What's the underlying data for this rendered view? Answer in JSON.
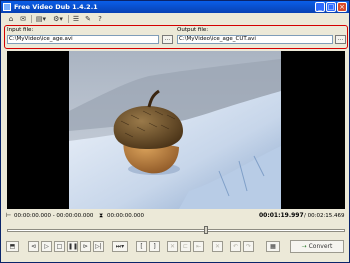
{
  "window": {
    "title": "Free Video Dub 1.4.2.1",
    "controls": {
      "minimize": "_",
      "maximize": "□",
      "close": "×"
    }
  },
  "toolbar": {
    "items": [
      {
        "icon": "home-icon",
        "glyph": "⌂"
      },
      {
        "icon": "mail-icon",
        "glyph": "✉"
      },
      {
        "icon": "video-dropdown-icon",
        "glyph": "▤▾"
      },
      {
        "icon": "settings-dropdown-icon",
        "glyph": "⚙▾"
      },
      {
        "icon": "list-icon",
        "glyph": "☰"
      },
      {
        "icon": "edit-icon",
        "glyph": "✎"
      },
      {
        "icon": "help-icon",
        "glyph": "?"
      }
    ]
  },
  "files": {
    "input_label": "Input file:",
    "input_value": "C:\\MyVideo\\ice_age.avi",
    "output_label": "Output file:",
    "output_value": "C:\\MyVideo\\ice_age_CUT.avi",
    "browse_label": "..."
  },
  "status": {
    "selection_range": "00:00:00.000 - 00:00:00.000",
    "cut_time": "00:00:00.000",
    "current_time": "00:01:19.997",
    "total_time": "/ 00:02:15.469"
  },
  "timeline": {
    "position": 0.59
  },
  "controls": {
    "convert_label": "Convert"
  },
  "colors": {
    "highlight_border": "#d40000",
    "title_bar": "#0a5ee8",
    "window_bg": "#ece9d8"
  }
}
